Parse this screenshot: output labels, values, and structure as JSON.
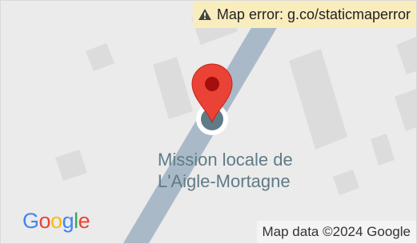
{
  "map": {
    "error_text": "Map error: g.co/staticmaperror",
    "place_label_line1": "Mission locale de",
    "place_label_line2": "L'Aigle-Mortagne",
    "google_logo": {
      "G": "G",
      "o1": "o",
      "o2": "o",
      "g": "g",
      "l": "l",
      "e": "e"
    },
    "attribution": "Map data ©2024 Google"
  },
  "colors": {
    "background": "#ebebeb",
    "road": "#aab9c8",
    "building": "#dcdcdc",
    "marker": "#ea4335",
    "poi": "#5f7b86",
    "banner": "#f9edbe"
  },
  "icons": {
    "marker": "red-location-pin-icon",
    "poi": "poi-circle-icon",
    "warning": "warning-triangle-icon"
  }
}
